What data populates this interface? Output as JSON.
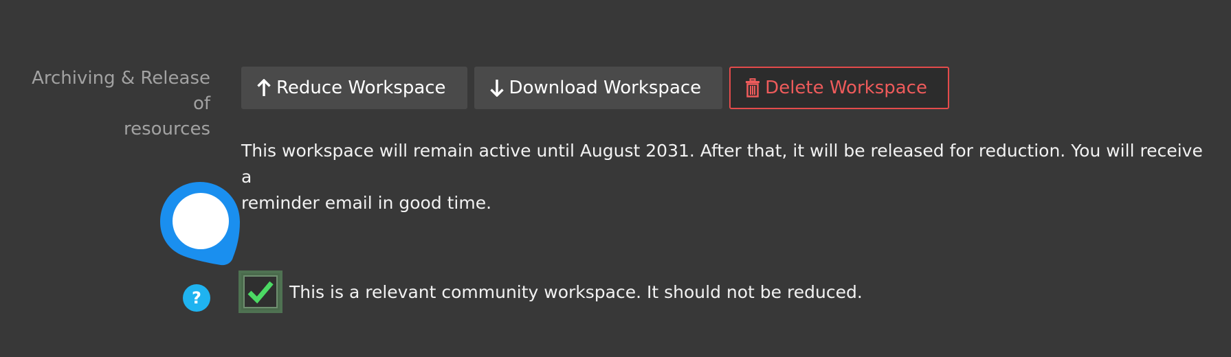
{
  "section": {
    "label_line1": "Archiving & Release of",
    "label_line2": "resources"
  },
  "toolbar": {
    "reduce": {
      "label": "Reduce Workspace",
      "icon": "arrow-up-icon"
    },
    "download": {
      "label": "Download Workspace",
      "icon": "arrow-down-icon"
    },
    "delete": {
      "label": "Delete Workspace",
      "icon": "trash-icon"
    }
  },
  "notice": {
    "line1": "This workspace will remain active until August 2031. After that, it will be released for reduction. You will receive a",
    "line2": "reminder email in good time."
  },
  "help": {
    "glyph": "?"
  },
  "checkbox": {
    "checked": true,
    "label": "This is a relevant community workspace. It should not be reduced."
  },
  "colors": {
    "background": "#383838",
    "button": "#4a4a4a",
    "danger": "#ee5b5b",
    "pin": "#1a8fef",
    "help": "#1fb3f0",
    "check": "#4cd964"
  }
}
